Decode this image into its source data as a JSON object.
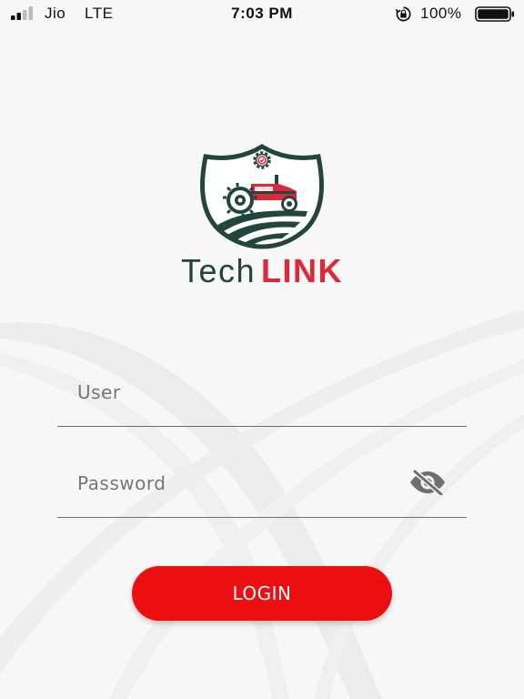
{
  "status_bar": {
    "carrier": "Jio",
    "network": "LTE",
    "time": "7:03 PM",
    "battery_percent": "100%",
    "signal_icon": "cellular-signal-icon",
    "rotation_lock_icon": "rotation-lock-icon",
    "battery_icon": "battery-full-icon"
  },
  "brand": {
    "name_part1": "Tech",
    "name_part2": "LINK",
    "logo_icon": "tractor-shield-logo",
    "colors": {
      "dark_green": "#22453d",
      "red": "#e0283b"
    }
  },
  "login_form": {
    "user_placeholder": "User",
    "user_value": "",
    "password_placeholder": "Password",
    "password_value": "",
    "password_toggle_icon": "eye-off-icon",
    "login_label": "LOGIN",
    "button_color": "#ec0e10"
  }
}
